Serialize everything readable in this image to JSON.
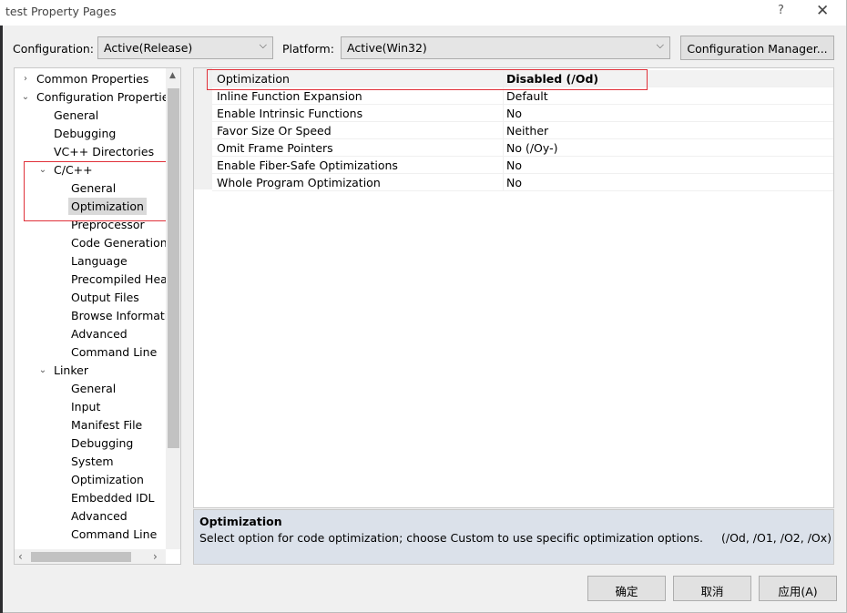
{
  "window": {
    "title": "test Property Pages",
    "help_glyph": "?",
    "close_glyph": "✕"
  },
  "config": {
    "configuration_label": "Configuration:",
    "configuration_value": "Active(Release)",
    "platform_label": "Platform:",
    "platform_value": "Active(Win32)",
    "manager_button": "Configuration Manager..."
  },
  "tree": {
    "items": [
      {
        "label": "Common Properties"
      },
      {
        "label": "Configuration Properties"
      },
      {
        "label": "General"
      },
      {
        "label": "Debugging"
      },
      {
        "label": "VC++ Directories"
      },
      {
        "label": "C/C++"
      },
      {
        "label": "General"
      },
      {
        "label": "Optimization"
      },
      {
        "label": "Preprocessor"
      },
      {
        "label": "Code Generation"
      },
      {
        "label": "Language"
      },
      {
        "label": "Precompiled Headers"
      },
      {
        "label": "Output Files"
      },
      {
        "label": "Browse Information"
      },
      {
        "label": "Advanced"
      },
      {
        "label": "Command Line"
      },
      {
        "label": "Linker"
      },
      {
        "label": "General"
      },
      {
        "label": "Input"
      },
      {
        "label": "Manifest File"
      },
      {
        "label": "Debugging"
      },
      {
        "label": "System"
      },
      {
        "label": "Optimization"
      },
      {
        "label": "Embedded IDL"
      },
      {
        "label": "Advanced"
      },
      {
        "label": "Command Line"
      }
    ]
  },
  "grid": {
    "rows": [
      {
        "name": "Optimization",
        "value": "Disabled (/Od)"
      },
      {
        "name": "Inline Function Expansion",
        "value": "Default"
      },
      {
        "name": "Enable Intrinsic Functions",
        "value": "No"
      },
      {
        "name": "Favor Size Or Speed",
        "value": "Neither"
      },
      {
        "name": "Omit Frame Pointers",
        "value": "No (/Oy-)"
      },
      {
        "name": "Enable Fiber-Safe Optimizations",
        "value": "No"
      },
      {
        "name": "Whole Program Optimization",
        "value": "No"
      }
    ]
  },
  "description": {
    "title": "Optimization",
    "text": "Select option for code optimization; choose Custom to use specific optimization options.",
    "options": "(/Od, /O1, /O2, /Ox)"
  },
  "buttons": {
    "ok": "确定",
    "cancel": "取消",
    "apply": "应用(A)"
  },
  "colors": {
    "highlight_border": "#e0313a",
    "selected_tree_bg": "#d9d9d9",
    "description_bg": "#dbe1ea"
  }
}
